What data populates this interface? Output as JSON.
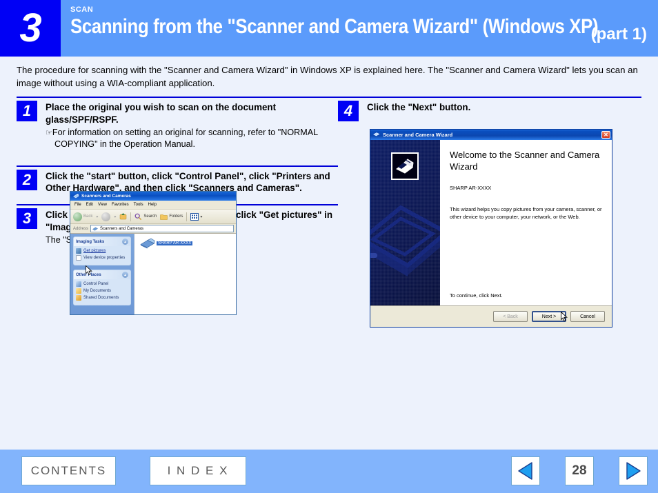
{
  "header": {
    "chapter_number": "3",
    "kicker": "SCAN",
    "title": "Scanning from the \"Scanner and Camera Wizard\" (Windows XP)",
    "part_label": "(part 1)",
    "band_color": "#5b9bfb",
    "chapter_block_color": "#0000f5"
  },
  "intro": {
    "text": "The procedure for scanning with the \"Scanner and Camera Wizard\" in Windows XP is explained here. The \"Scanner and Camera Wizard\" lets you scan an image without using a WIA-compliant application."
  },
  "steps": {
    "left": [
      {
        "number": "1",
        "title": "Place the original you wish to scan on the document glass/SPF/RSPF.",
        "note": "For information on setting an original for scanning, refer to \"NORMAL COPYING\" in the Operation Manual."
      },
      {
        "number": "2",
        "title": "Click the \"start\" button, click \"Control Panel\", click \"Printers and Other Hardware\", and then click \"Scanners and Cameras\"."
      },
      {
        "number": "3",
        "title": "Click the \"SHARP AR-XXXX\"    icon and then click \"Get pictures\" in \"Imaging Tasks\".",
        "sub": "The \"Scanner and Camera Wizard\" will appear."
      }
    ],
    "right": [
      {
        "number": "4",
        "title": "Click the \"Next\" button."
      }
    ]
  },
  "explorer_window": {
    "title": "Scanners and Cameras",
    "menus": [
      "File",
      "Edit",
      "View",
      "Favorites",
      "Tools",
      "Help"
    ],
    "toolbar": {
      "back": "Back",
      "search": "Search",
      "folders": "Folders"
    },
    "address_label": "Address",
    "address_value": "Scanners and Cameras",
    "panels": [
      {
        "title": "Imaging Tasks",
        "links": [
          "Get pictures",
          "View device properties"
        ]
      },
      {
        "title": "Other Places",
        "links": [
          "Control Panel",
          "My Documents",
          "Shared Documents"
        ]
      }
    ],
    "device_label": "SHARP AR-XXXX"
  },
  "wizard_dialog": {
    "title": "Scanner and Camera Wizard",
    "close_label": "✕",
    "heading": "Welcome to the Scanner and Camera Wizard",
    "device": "SHARP AR-XXXX",
    "body_text": "This wizard helps you copy pictures from your camera, scanner, or other device to your computer, your network, or the Web.",
    "continue_text": "To continue, click Next.",
    "buttons": {
      "back": "< Back",
      "next": "Next >",
      "cancel": "Cancel"
    }
  },
  "footer": {
    "contents_label": "CONTENTS",
    "index_label": "I N D E X",
    "page_number": "28",
    "band_color": "#82b4fc"
  }
}
